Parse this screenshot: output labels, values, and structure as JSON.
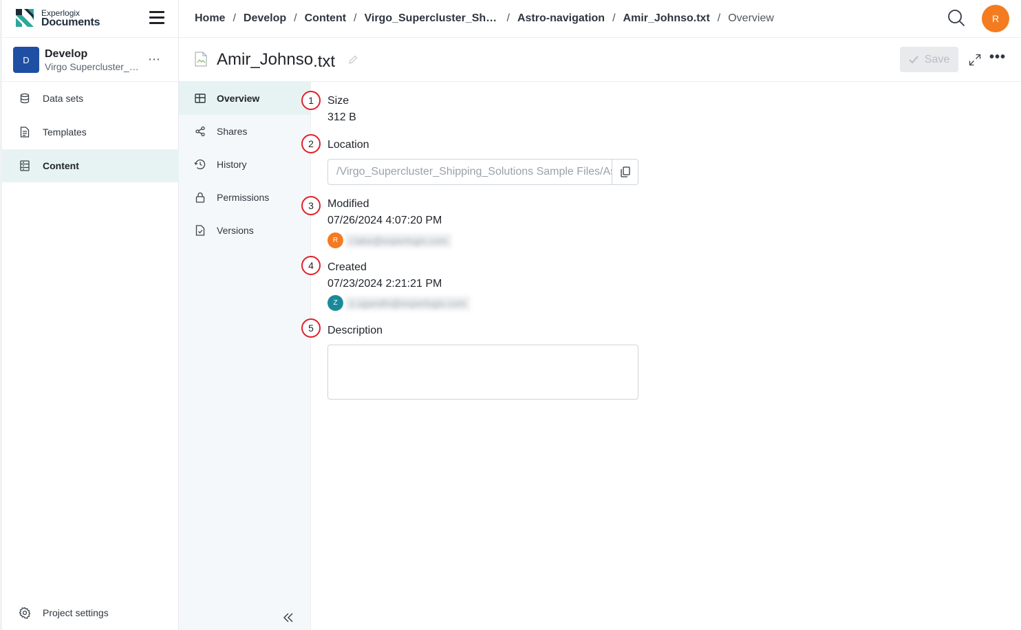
{
  "brand": {
    "small": "Experlogix",
    "big": "Documents"
  },
  "project": {
    "badge": "D",
    "name": "Develop",
    "subtitle": "Virgo Supercluster_Shipping_Solutions",
    "more": "⋯"
  },
  "sidebar": {
    "items": [
      {
        "label": "Data sets",
        "icon": "database-icon"
      },
      {
        "label": "Templates",
        "icon": "template-icon"
      },
      {
        "label": "Content",
        "icon": "content-icon",
        "active": true
      }
    ],
    "settings_label": "Project settings"
  },
  "breadcrumb": {
    "items": [
      "Home",
      "Develop",
      "Content",
      "Virgo_Supercluster_Shipping_Solutions",
      "Astro-navigation",
      "Amir_Johnso.txt"
    ],
    "current": "Overview",
    "separator": "/"
  },
  "user": {
    "initial": "R",
    "color": "#f47b20"
  },
  "file": {
    "name": "Amir_Johnso",
    "ext": ".txt"
  },
  "toolbar": {
    "save_label": "Save",
    "more": "•••"
  },
  "subnav": {
    "items": [
      {
        "label": "Overview",
        "icon": "grid-icon",
        "active": true
      },
      {
        "label": "Shares",
        "icon": "share-icon"
      },
      {
        "label": "History",
        "icon": "history-icon"
      },
      {
        "label": "Permissions",
        "icon": "lock-icon"
      },
      {
        "label": "Versions",
        "icon": "file-check-icon"
      }
    ]
  },
  "overview": {
    "markers": [
      "1",
      "2",
      "3",
      "4",
      "5"
    ],
    "size": {
      "label": "Size",
      "value": "312 B"
    },
    "location": {
      "label": "Location",
      "value": "/Virgo_Supercluster_Shipping_Solutions Sample Files/Astro-navigation/Amir_Johnso.txt"
    },
    "modified": {
      "label": "Modified",
      "value": "07/26/2024 4:07:20 PM",
      "user_initial": "R",
      "user_color": "#f47b20",
      "user_email": "r.lake@experlogix.com"
    },
    "created": {
      "label": "Created",
      "value": "07/23/2024 2:21:21 PM",
      "user_initial": "Z",
      "user_color": "#1a8a9a",
      "user_email": "z.ugandhi@experlogix.com"
    },
    "description": {
      "label": "Description",
      "value": ""
    }
  },
  "colors": {
    "accent_active_bg": "#e7f3f2",
    "project_badge": "#1e4fa3",
    "marker": "#e0202a"
  }
}
